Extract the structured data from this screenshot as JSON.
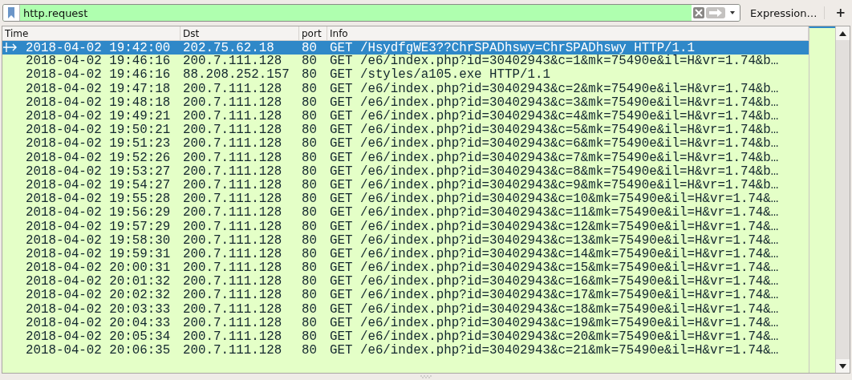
{
  "filter": {
    "value": "http.request"
  },
  "toolbar": {
    "expression": "Expression…",
    "add": "+"
  },
  "table": {
    "columns": [
      "Time",
      "Dst",
      "port",
      "Info"
    ],
    "rows": [
      {
        "time": "2018-04-02 19:42:00",
        "dst": "202.75.62.18",
        "port": "80",
        "info": "GET /HsydfgWE3??ChrSPADhswy=ChrSPADhswy HTTP/1.1",
        "selected": true,
        "arrow": true
      },
      {
        "time": "2018-04-02 19:46:16",
        "dst": "200.7.111.128",
        "port": "80",
        "info": "GET /e6/index.php?id=30402943&c=1&mk=75490e&il=H&vr=1.74&b…",
        "selected": false,
        "arrow": false
      },
      {
        "time": "2018-04-02 19:46:16",
        "dst": "88.208.252.157",
        "port": "80",
        "info": "GET /styles/a105.exe HTTP/1.1",
        "selected": false,
        "arrow": false
      },
      {
        "time": "2018-04-02 19:47:18",
        "dst": "200.7.111.128",
        "port": "80",
        "info": "GET /e6/index.php?id=30402943&c=2&mk=75490e&il=H&vr=1.74&b…",
        "selected": false,
        "arrow": false
      },
      {
        "time": "2018-04-02 19:48:18",
        "dst": "200.7.111.128",
        "port": "80",
        "info": "GET /e6/index.php?id=30402943&c=3&mk=75490e&il=H&vr=1.74&b…",
        "selected": false,
        "arrow": false
      },
      {
        "time": "2018-04-02 19:49:21",
        "dst": "200.7.111.128",
        "port": "80",
        "info": "GET /e6/index.php?id=30402943&c=4&mk=75490e&il=H&vr=1.74&b…",
        "selected": false,
        "arrow": false
      },
      {
        "time": "2018-04-02 19:50:21",
        "dst": "200.7.111.128",
        "port": "80",
        "info": "GET /e6/index.php?id=30402943&c=5&mk=75490e&il=H&vr=1.74&b…",
        "selected": false,
        "arrow": false
      },
      {
        "time": "2018-04-02 19:51:23",
        "dst": "200.7.111.128",
        "port": "80",
        "info": "GET /e6/index.php?id=30402943&c=6&mk=75490e&il=H&vr=1.74&b…",
        "selected": false,
        "arrow": false
      },
      {
        "time": "2018-04-02 19:52:26",
        "dst": "200.7.111.128",
        "port": "80",
        "info": "GET /e6/index.php?id=30402943&c=7&mk=75490e&il=H&vr=1.74&b…",
        "selected": false,
        "arrow": false
      },
      {
        "time": "2018-04-02 19:53:27",
        "dst": "200.7.111.128",
        "port": "80",
        "info": "GET /e6/index.php?id=30402943&c=8&mk=75490e&il=H&vr=1.74&b…",
        "selected": false,
        "arrow": false
      },
      {
        "time": "2018-04-02 19:54:27",
        "dst": "200.7.111.128",
        "port": "80",
        "info": "GET /e6/index.php?id=30402943&c=9&mk=75490e&il=H&vr=1.74&b…",
        "selected": false,
        "arrow": false
      },
      {
        "time": "2018-04-02 19:55:28",
        "dst": "200.7.111.128",
        "port": "80",
        "info": "GET /e6/index.php?id=30402943&c=10&mk=75490e&il=H&vr=1.74&…",
        "selected": false,
        "arrow": false
      },
      {
        "time": "2018-04-02 19:56:29",
        "dst": "200.7.111.128",
        "port": "80",
        "info": "GET /e6/index.php?id=30402943&c=11&mk=75490e&il=H&vr=1.74&…",
        "selected": false,
        "arrow": false
      },
      {
        "time": "2018-04-02 19:57:29",
        "dst": "200.7.111.128",
        "port": "80",
        "info": "GET /e6/index.php?id=30402943&c=12&mk=75490e&il=H&vr=1.74&…",
        "selected": false,
        "arrow": false
      },
      {
        "time": "2018-04-02 19:58:30",
        "dst": "200.7.111.128",
        "port": "80",
        "info": "GET /e6/index.php?id=30402943&c=13&mk=75490e&il=H&vr=1.74&…",
        "selected": false,
        "arrow": false
      },
      {
        "time": "2018-04-02 19:59:31",
        "dst": "200.7.111.128",
        "port": "80",
        "info": "GET /e6/index.php?id=30402943&c=14&mk=75490e&il=H&vr=1.74&…",
        "selected": false,
        "arrow": false
      },
      {
        "time": "2018-04-02 20:00:31",
        "dst": "200.7.111.128",
        "port": "80",
        "info": "GET /e6/index.php?id=30402943&c=15&mk=75490e&il=H&vr=1.74&…",
        "selected": false,
        "arrow": false
      },
      {
        "time": "2018-04-02 20:01:32",
        "dst": "200.7.111.128",
        "port": "80",
        "info": "GET /e6/index.php?id=30402943&c=16&mk=75490e&il=H&vr=1.74&…",
        "selected": false,
        "arrow": false
      },
      {
        "time": "2018-04-02 20:02:32",
        "dst": "200.7.111.128",
        "port": "80",
        "info": "GET /e6/index.php?id=30402943&c=17&mk=75490e&il=H&vr=1.74&…",
        "selected": false,
        "arrow": false
      },
      {
        "time": "2018-04-02 20:03:33",
        "dst": "200.7.111.128",
        "port": "80",
        "info": "GET /e6/index.php?id=30402943&c=18&mk=75490e&il=H&vr=1.74&…",
        "selected": false,
        "arrow": false
      },
      {
        "time": "2018-04-02 20:04:33",
        "dst": "200.7.111.128",
        "port": "80",
        "info": "GET /e6/index.php?id=30402943&c=19&mk=75490e&il=H&vr=1.74&…",
        "selected": false,
        "arrow": false
      },
      {
        "time": "2018-04-02 20:05:34",
        "dst": "200.7.111.128",
        "port": "80",
        "info": "GET /e6/index.php?id=30402943&c=20&mk=75490e&il=H&vr=1.74&…",
        "selected": false,
        "arrow": false
      },
      {
        "time": "2018-04-02 20:06:35",
        "dst": "200.7.111.128",
        "port": "80",
        "info": "GET /e6/index.php?id=30402943&c=21&mk=75490e&il=H&vr=1.74&…",
        "selected": false,
        "arrow": false
      }
    ]
  }
}
